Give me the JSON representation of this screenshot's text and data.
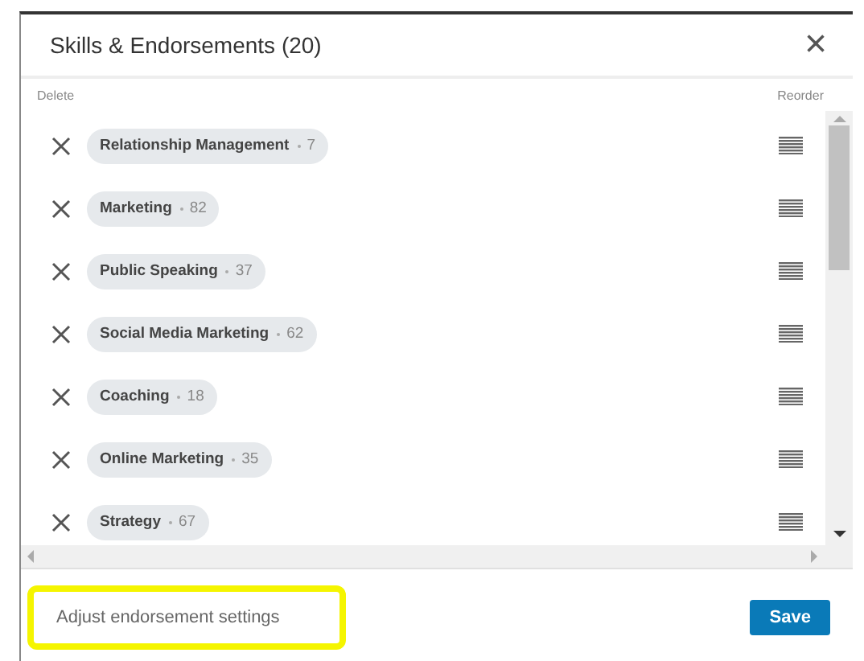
{
  "dialog": {
    "title": "Skills & Endorsements (20)",
    "close": "×"
  },
  "columns": {
    "left": "Delete",
    "right": "Reorder"
  },
  "skills": [
    {
      "name": "Relationship Management",
      "count": "7"
    },
    {
      "name": "Marketing",
      "count": "82"
    },
    {
      "name": "Public Speaking",
      "count": "37"
    },
    {
      "name": "Social Media Marketing",
      "count": "62"
    },
    {
      "name": "Coaching",
      "count": "18"
    },
    {
      "name": "Online Marketing",
      "count": "35"
    },
    {
      "name": "Strategy",
      "count": "67"
    }
  ],
  "footer": {
    "link": "Adjust endorsement settings",
    "highlighted": true,
    "button": "Save"
  }
}
